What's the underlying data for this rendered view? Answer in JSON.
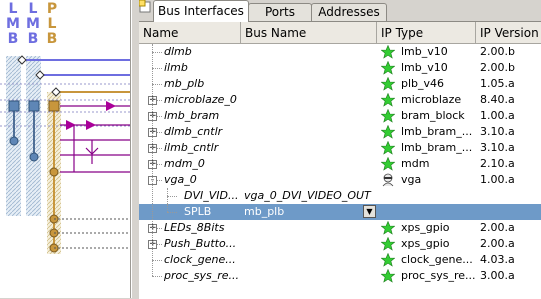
{
  "bus_panel": {
    "labels": [
      {
        "text": "L\nM\nB",
        "color": "#6e6ee0"
      },
      {
        "text": "L\nM\nB",
        "color": "#6e6ee0"
      },
      {
        "text": "P\nL\nB",
        "color": "#c8963c"
      }
    ]
  },
  "tabs": [
    {
      "label": "Bus Interfaces",
      "active": true
    },
    {
      "label": "Ports",
      "active": false
    },
    {
      "label": "Addresses",
      "active": false
    }
  ],
  "columns": [
    "Name",
    "Bus Name",
    "IP Type",
    "IP Version"
  ],
  "rows": [
    {
      "name": "dlmb",
      "bus": "",
      "type": "lmb_v10",
      "version": "2.00.b",
      "level": 0,
      "expander": "",
      "icon": "star",
      "italic": true
    },
    {
      "name": "ilmb",
      "bus": "",
      "type": "lmb_v10",
      "version": "2.00.b",
      "level": 0,
      "expander": "",
      "icon": "star",
      "italic": true
    },
    {
      "name": "mb_plb",
      "bus": "",
      "type": "plb_v46",
      "version": "1.05.a",
      "level": 0,
      "expander": "",
      "icon": "star",
      "italic": true
    },
    {
      "name": "microblaze_0",
      "bus": "",
      "type": "microblaze",
      "version": "8.40.a",
      "level": 0,
      "expander": "+",
      "icon": "star",
      "italic": true
    },
    {
      "name": "lmb_bram",
      "bus": "",
      "type": "bram_block",
      "version": "1.00.a",
      "level": 0,
      "expander": "+",
      "icon": "star",
      "italic": true
    },
    {
      "name": "dlmb_cntlr",
      "bus": "",
      "type": "lmb_bram_...",
      "version": "3.10.a",
      "level": 0,
      "expander": "+",
      "icon": "star",
      "italic": true
    },
    {
      "name": "ilmb_cntlr",
      "bus": "",
      "type": "lmb_bram_...",
      "version": "3.10.a",
      "level": 0,
      "expander": "+",
      "icon": "star",
      "italic": true
    },
    {
      "name": "mdm_0",
      "bus": "",
      "type": "mdm",
      "version": "2.10.a",
      "level": 0,
      "expander": "+",
      "icon": "star",
      "italic": true
    },
    {
      "name": "vga_0",
      "bus": "",
      "type": "vga",
      "version": "1.00.a",
      "level": 0,
      "expander": "-",
      "icon": "user",
      "italic": true
    },
    {
      "name": "DVI_VID...",
      "bus": "vga_0_DVI_VIDEO_OUT",
      "type": "",
      "version": "",
      "level": 1,
      "expander": "",
      "icon": "",
      "italic": true
    },
    {
      "name": "SPLB",
      "bus": "mb_plb",
      "type": "",
      "version": "",
      "level": 1,
      "expander": "",
      "icon": "",
      "italic": false,
      "selected": true,
      "dropdown": true
    },
    {
      "name": "LEDs_8Bits",
      "bus": "",
      "type": "xps_gpio",
      "version": "2.00.a",
      "level": 0,
      "expander": "+",
      "icon": "star",
      "italic": true
    },
    {
      "name": "Push_Butto...",
      "bus": "",
      "type": "xps_gpio",
      "version": "2.00.a",
      "level": 0,
      "expander": "+",
      "icon": "star",
      "italic": true
    },
    {
      "name": "clock_gene...",
      "bus": "",
      "type": "clock_gene...",
      "version": "4.03.a",
      "level": 0,
      "expander": "",
      "icon": "star",
      "italic": true
    },
    {
      "name": "proc_sys_re...",
      "bus": "",
      "type": "proc_sys_re...",
      "version": "3.00.a",
      "level": 0,
      "expander": "",
      "icon": "star",
      "italic": true
    }
  ],
  "colors": {
    "lmb_bus": "#6e6ee0",
    "plb_bus": "#c8963c",
    "selection": "#6e9ac8",
    "star_green": "#33cc33"
  }
}
